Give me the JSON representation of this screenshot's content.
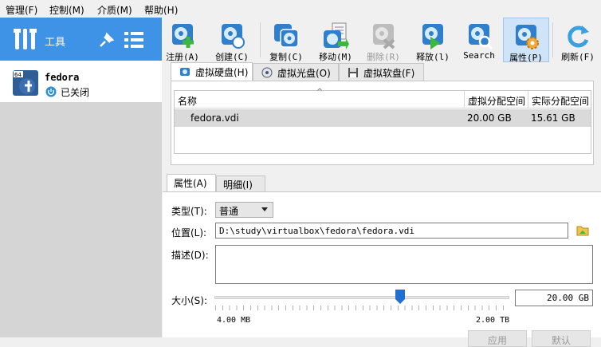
{
  "menu": [
    "管理(F)",
    "控制(M)",
    "介质(M)",
    "帮助(H)"
  ],
  "sidebar": {
    "tools_label": "工具",
    "vm": {
      "name": "fedora",
      "state": "已关闭"
    }
  },
  "toolbar": {
    "items": [
      {
        "label": "注册(A)",
        "icon": "register-icon",
        "enabled": true
      },
      {
        "label": "创建(C)",
        "icon": "create-icon",
        "enabled": true
      },
      {
        "label": "复制(C)",
        "icon": "copy-icon",
        "enabled": true
      },
      {
        "label": "移动(M)",
        "icon": "move-icon",
        "enabled": true
      },
      {
        "label": "删除(R)",
        "icon": "delete-icon",
        "enabled": false
      },
      {
        "label": "释放(l)",
        "icon": "release-icon",
        "enabled": true
      },
      {
        "label": "Search",
        "icon": "search-icon",
        "enabled": true
      },
      {
        "label": "属性(P)",
        "icon": "properties-icon",
        "enabled": true,
        "active": true
      },
      {
        "label": "刷新(F)",
        "icon": "refresh-icon",
        "enabled": true
      }
    ]
  },
  "media_tabs": [
    "虚拟硬盘(H)",
    "虚拟光盘(O)",
    "虚拟软盘(F)"
  ],
  "table": {
    "headers": [
      "名称",
      "虚拟分配空间",
      "实际分配空间"
    ],
    "rows": [
      {
        "name": "fedora.vdi",
        "virtual": "20.00 GB",
        "actual": "15.61 GB"
      }
    ]
  },
  "prop_tabs": [
    "属性(A)",
    "明细(I)"
  ],
  "props": {
    "type_label": "类型(T):",
    "type_value": "普通",
    "location_label": "位置(L):",
    "location_value": "D:\\study\\virtualbox\\fedora\\fedora.vdi",
    "desc_label": "描述(D):",
    "desc_value": "",
    "size_label": "大小(S):",
    "size_value": "20.00 GB",
    "size_min": "4.00 MB",
    "size_max": "2.00 TB",
    "slider_fraction": 0.63,
    "apply_label": "应用",
    "reset_label": "默认"
  }
}
